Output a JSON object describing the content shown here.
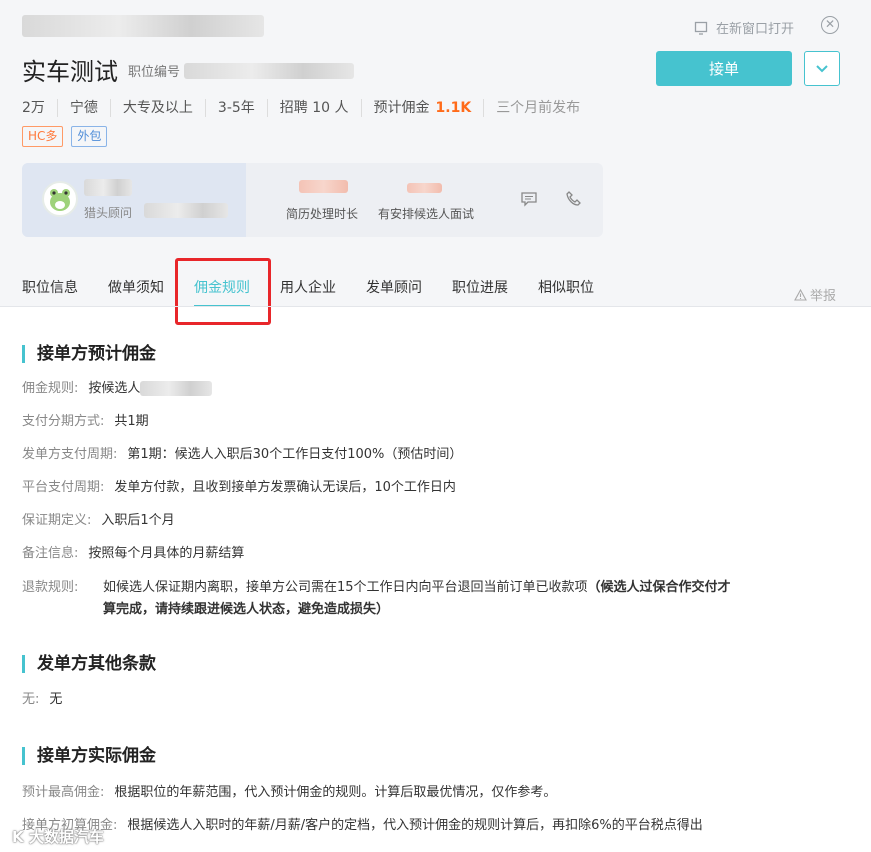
{
  "header": {
    "open_new_window": "在新窗口打开",
    "title": "实车测试",
    "job_no_label": "职位编号",
    "accept_button": "接单",
    "meta": {
      "salary": "2万",
      "city": "宁德",
      "education": "大专及以上",
      "experience": "3-5年",
      "hiring_prefix": "招聘",
      "hiring_count": "10",
      "hiring_suffix": "人",
      "commission_label": "预计佣金",
      "commission_value": "1.1K",
      "published": "三个月前发布"
    },
    "tags": [
      "HC多",
      "外包"
    ]
  },
  "card": {
    "headhunter_label": "猎头顾问",
    "stat1_label": "简历处理时长",
    "stat2_label": "有安排候选人面试"
  },
  "tabs": [
    "职位信息",
    "做单须知",
    "佣金规则",
    "用人企业",
    "发单顾问",
    "职位进展",
    "相似职位"
  ],
  "active_tab": "佣金规则",
  "report": "举报",
  "sections": {
    "s1": {
      "title": "接单方预计佣金",
      "rows": [
        {
          "label": "佣金规则:",
          "value": "按候选人"
        },
        {
          "label": "支付分期方式:",
          "value": "共1期"
        },
        {
          "label": "发单方支付周期:",
          "value": "第1期：候选人入职后30个工作日支付100%（预估时间）"
        },
        {
          "label": "平台支付周期:",
          "value": "发单方付款，且收到接单方发票确认无误后，10个工作日内"
        },
        {
          "label": "保证期定义:",
          "value": "入职后1个月"
        },
        {
          "label": "备注信息:",
          "value": "按照每个月具体的月薪结算"
        }
      ],
      "refund_label": "退款规则:",
      "refund_text": "如候选人保证期内离职，接单方公司需在15个工作日内向平台退回当前订单已收款项",
      "refund_bold_1": "（候选人过保合作交付才",
      "refund_bold_2": "算完成，请持续跟进候选人状态，避免造成损失）"
    },
    "s2": {
      "title": "发单方其他条款",
      "label": "无:",
      "value": "无"
    },
    "s3": {
      "title": "接单方实际佣金",
      "rows": [
        {
          "label": "预计最高佣金:",
          "value": "根据职位的年薪范围，代入预计佣金的规则。计算后取最优情况，仅作参考。"
        },
        {
          "label": "接单方初算佣金:",
          "value": "根据候选人入职时的年薪/月薪/客户的定档，代入预计佣金的规则计算后，再扣除6%的平台税点得出"
        }
      ]
    }
  },
  "watermark": "K 大数据汽车",
  "colors": {
    "accent": "#46c3cf",
    "highlight": "#ff6b1a",
    "annotation": "#e8262a"
  }
}
